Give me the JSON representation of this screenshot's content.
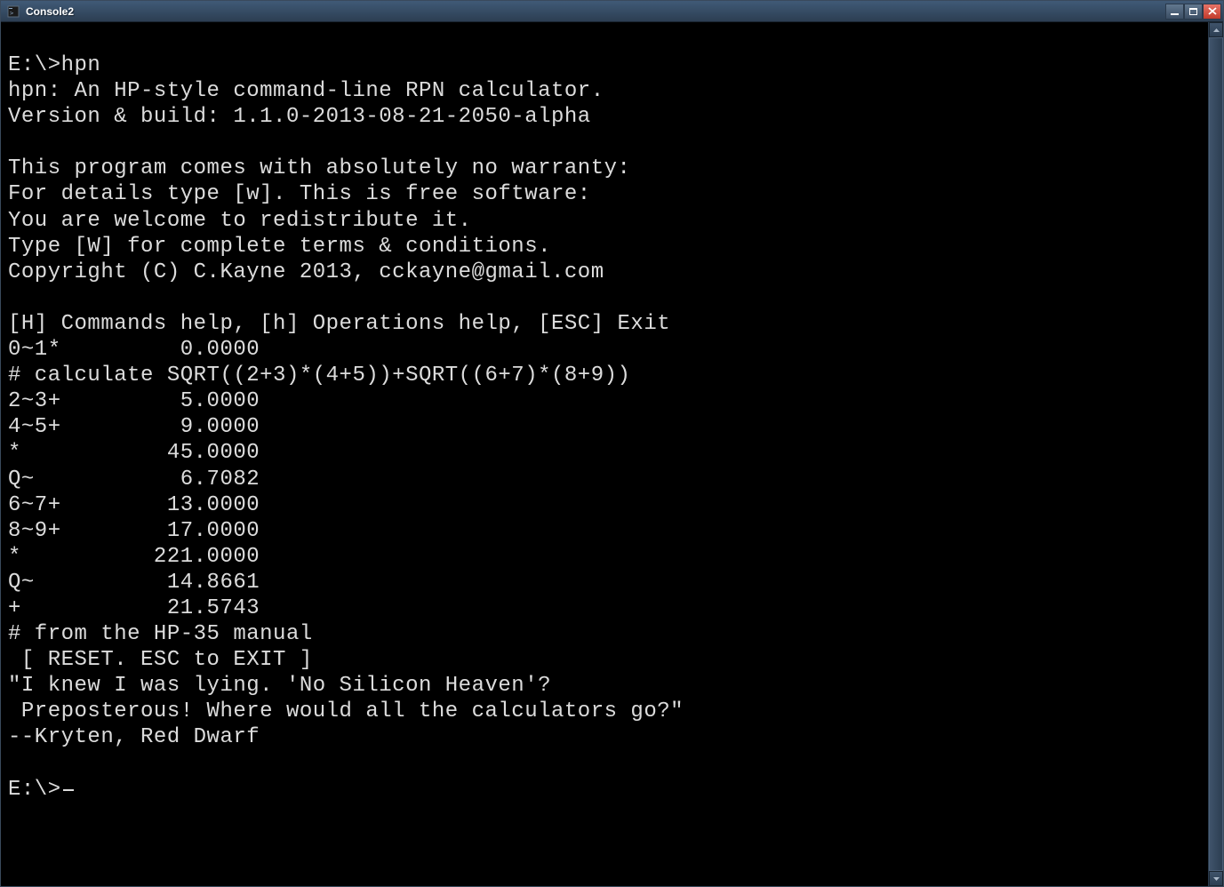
{
  "window": {
    "title": "Console2"
  },
  "terminal": {
    "lines": [
      "E:\\>hpn",
      "hpn: An HP-style command-line RPN calculator.",
      "Version & build: 1.1.0-2013-08-21-2050-alpha",
      "",
      "This program comes with absolutely no warranty:",
      "For details type [w]. This is free software:",
      "You are welcome to redistribute it.",
      "Type [W] for complete terms & conditions.",
      "Copyright (C) C.Kayne 2013, cckayne@gmail.com",
      "",
      "[H] Commands help, [h] Operations help, [ESC] Exit",
      "0~1*         0.0000",
      "# calculate SQRT((2+3)*(4+5))+SQRT((6+7)*(8+9))",
      "2~3+         5.0000",
      "4~5+         9.0000",
      "*           45.0000",
      "Q~           6.7082",
      "6~7+        13.0000",
      "8~9+        17.0000",
      "*          221.0000",
      "Q~          14.8661",
      "+           21.5743",
      "# from the HP-35 manual",
      " [ RESET. ESC to EXIT ]",
      "\"I knew I was lying. 'No Silicon Heaven'?",
      " Preposterous! Where would all the calculators go?\"",
      "--Kryten, Red Dwarf",
      ""
    ],
    "prompt": "E:\\>"
  }
}
